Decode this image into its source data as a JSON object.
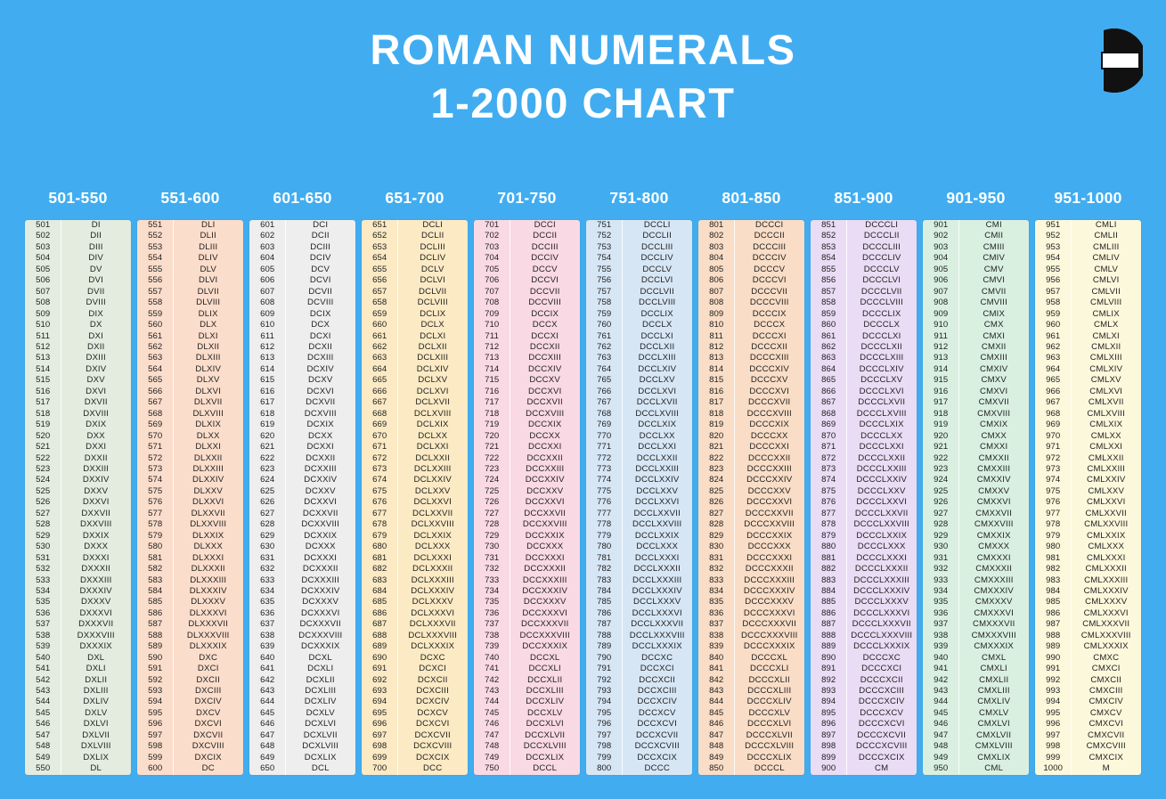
{
  "page": {
    "background_color": "#41adf0",
    "title_line1": "ROMAN NUMERALS",
    "title_line2": "1-2000 CHART"
  },
  "logo": {
    "name": "brand-logo",
    "shape": "semicircle-c-with-white-bar",
    "color": "#111111",
    "bar_color": "#ffffff"
  },
  "columns": [
    {
      "header": "501-550",
      "bg": "#e3ecdf",
      "start": 501,
      "end": 550,
      "numerals": [
        "DI",
        "DII",
        "DIII",
        "DIV",
        "DV",
        "DVI",
        "DVII",
        "DVIII",
        "DIX",
        "DX",
        "DXI",
        "DXII",
        "DXIII",
        "DXIV",
        "DXV",
        "DXVI",
        "DXVII",
        "DXVIII",
        "DXIX",
        "DXX",
        "DXXI",
        "DXXII",
        "DXXIII",
        "DXXIV",
        "DXXV",
        "DXXVI",
        "DXXVII",
        "DXXVIII",
        "DXXIX",
        "DXXX",
        "DXXXI",
        "DXXXII",
        "DXXXIII",
        "DXXXIV",
        "DXXXV",
        "DXXXVI",
        "DXXXVII",
        "DXXXVIII",
        "DXXXIX",
        "DXL",
        "DXLI",
        "DXLII",
        "DXLIII",
        "DXLIV",
        "DXLV",
        "DXLVI",
        "DXLVII",
        "DXLVIII",
        "DXLIX",
        "DL"
      ]
    },
    {
      "header": "551-600",
      "bg": "#fbddcb",
      "start": 551,
      "end": 600,
      "numerals": [
        "DLI",
        "DLII",
        "DLIII",
        "DLIV",
        "DLV",
        "DLVI",
        "DLVII",
        "DLVIII",
        "DLIX",
        "DLX",
        "DLXI",
        "DLXII",
        "DLXIII",
        "DLXIV",
        "DLXV",
        "DLXVI",
        "DLXVII",
        "DLXVIII",
        "DLXIX",
        "DLXX",
        "DLXXI",
        "DLXXII",
        "DLXXIII",
        "DLXXIV",
        "DLXXV",
        "DLXXVI",
        "DLXXVII",
        "DLXXVIII",
        "DLXXIX",
        "DLXXX",
        "DLXXXI",
        "DLXXXII",
        "DLXXXIII",
        "DLXXXIV",
        "DLXXXV",
        "DLXXXVI",
        "DLXXXVII",
        "DLXXXVIII",
        "DLXXXIX",
        "DXC",
        "DXCI",
        "DXCII",
        "DXCIII",
        "DXCIV",
        "DXCV",
        "DXCVI",
        "DXCVII",
        "DXCVIII",
        "DXCIX",
        "DC"
      ]
    },
    {
      "header": "601-650",
      "bg": "#eeeeee",
      "start": 601,
      "end": 650,
      "numerals": [
        "DCI",
        "DCII",
        "DCIII",
        "DCIV",
        "DCV",
        "DCVI",
        "DCVII",
        "DCVIII",
        "DCIX",
        "DCX",
        "DCXI",
        "DCXII",
        "DCXIII",
        "DCXIV",
        "DCXV",
        "DCXVI",
        "DCXVII",
        "DCXVIII",
        "DCXIX",
        "DCXX",
        "DCXXI",
        "DCXXII",
        "DCXXIII",
        "DCXXIV",
        "DCXXV",
        "DCXXVI",
        "DCXXVII",
        "DCXXVIII",
        "DCXXIX",
        "DCXXX",
        "DCXXXI",
        "DCXXXII",
        "DCXXXIII",
        "DCXXXIV",
        "DCXXXV",
        "DCXXXVI",
        "DCXXXVII",
        "DCXXXVIII",
        "DCXXXIX",
        "DCXL",
        "DCXLI",
        "DCXLII",
        "DCXLIII",
        "DCXLIV",
        "DCXLV",
        "DCXLVI",
        "DCXLVII",
        "DCXLVIII",
        "DCXLIX",
        "DCL"
      ]
    },
    {
      "header": "651-700",
      "bg": "#fbeac4",
      "start": 651,
      "end": 700,
      "numerals": [
        "DCLI",
        "DCLII",
        "DCLIII",
        "DCLIV",
        "DCLV",
        "DCLVI",
        "DCLVII",
        "DCLVIII",
        "DCLIX",
        "DCLX",
        "DCLXI",
        "DCLXII",
        "DCLXIII",
        "DCLXIV",
        "DCLXV",
        "DCLXVI",
        "DCLXVII",
        "DCLXVIII",
        "DCLXIX",
        "DCLXX",
        "DCLXXI",
        "DCLXXII",
        "DCLXXIII",
        "DCLXXIV",
        "DCLXXV",
        "DCLXXVI",
        "DCLXXVII",
        "DCLXXVIII",
        "DCLXXIX",
        "DCLXXX",
        "DCLXXXI",
        "DCLXXXII",
        "DCLXXXIII",
        "DCLXXXIV",
        "DCLXXXV",
        "DCLXXXVI",
        "DCLXXXVII",
        "DCLXXXVIII",
        "DCLXXXIX",
        "DCXC",
        "DCXCI",
        "DCXCII",
        "DCXCIII",
        "DCXCIV",
        "DCXCV",
        "DCXCVI",
        "DCXCVII",
        "DCXCVIII",
        "DCXCIX",
        "DCC"
      ]
    },
    {
      "header": "701-750",
      "bg": "#f9d9e4",
      "start": 701,
      "end": 750,
      "numerals": [
        "DCCI",
        "DCCII",
        "DCCIII",
        "DCCIV",
        "DCCV",
        "DCCVI",
        "DCCVII",
        "DCCVIII",
        "DCCIX",
        "DCCX",
        "DCCXI",
        "DCCXII",
        "DCCXIII",
        "DCCXIV",
        "DCCXV",
        "DCCXVI",
        "DCCXVII",
        "DCCXVIII",
        "DCCXIX",
        "DCCXX",
        "DCCXXI",
        "DCCXXII",
        "DCCXXIII",
        "DCCXXIV",
        "DCCXXV",
        "DCCXXVI",
        "DCCXXVII",
        "DCCXXVIII",
        "DCCXXIX",
        "DCCXXX",
        "DCCXXXI",
        "DCCXXXII",
        "DCCXXXIII",
        "DCCXXXIV",
        "DCCXXXV",
        "DCCXXXVI",
        "DCCXXXVII",
        "DCCXXXVIII",
        "DCCXXXIX",
        "DCCXL",
        "DCCXLI",
        "DCCXLII",
        "DCCXLIII",
        "DCCXLIV",
        "DCCXLV",
        "DCCXLVI",
        "DCCXLVII",
        "DCCXLVIII",
        "DCCXLIX",
        "DCCL"
      ]
    },
    {
      "header": "751-800",
      "bg": "#d7e6f5",
      "start": 751,
      "end": 800,
      "numerals": [
        "DCCLI",
        "DCCLII",
        "DCCLIII",
        "DCCLIV",
        "DCCLV",
        "DCCLVI",
        "DCCLVII",
        "DCCLVIII",
        "DCCLIX",
        "DCCLX",
        "DCCLXI",
        "DCCLXII",
        "DCCLXIII",
        "DCCLXIV",
        "DCCLXV",
        "DCCLXVI",
        "DCCLXVII",
        "DCCLXVIII",
        "DCCLXIX",
        "DCCLXX",
        "DCCLXXI",
        "DCCLXXII",
        "DCCLXXIII",
        "DCCLXXIV",
        "DCCLXXV",
        "DCCLXXVI",
        "DCCLXXVII",
        "DCCLXXVIII",
        "DCCLXXIX",
        "DCCLXXX",
        "DCCLXXXI",
        "DCCLXXXII",
        "DCCLXXXIII",
        "DCCLXXXIV",
        "DCCLXXXV",
        "DCCLXXXVI",
        "DCCLXXXVII",
        "DCCLXXXVIII",
        "DCCLXXXIX",
        "DCCXC",
        "DCCXCI",
        "DCCXCII",
        "DCCXCIII",
        "DCCXCIV",
        "DCCXCV",
        "DCCXCVI",
        "DCCXCVII",
        "DCCXCVIII",
        "DCCXCIX",
        "DCCC"
      ]
    },
    {
      "header": "801-850",
      "bg": "#f9ddc6",
      "start": 801,
      "end": 850,
      "numerals": [
        "DCCCI",
        "DCCCII",
        "DCCCIII",
        "DCCCIV",
        "DCCCV",
        "DCCCVI",
        "DCCCVII",
        "DCCCVIII",
        "DCCCIX",
        "DCCCX",
        "DCCCXI",
        "DCCCXII",
        "DCCCXIII",
        "DCCCXIV",
        "DCCCXV",
        "DCCCXVI",
        "DCCCXVII",
        "DCCCXVIII",
        "DCCCXIX",
        "DCCCXX",
        "DCCCXXI",
        "DCCCXXII",
        "DCCCXXIII",
        "DCCCXXIV",
        "DCCCXXV",
        "DCCCXXVI",
        "DCCCXXVII",
        "DCCCXXVIII",
        "DCCCXXIX",
        "DCCCXXX",
        "DCCCXXXI",
        "DCCCXXXII",
        "DCCCXXXIII",
        "DCCCXXXIV",
        "DCCCXXXV",
        "DCCCXXXVI",
        "DCCCXXXVII",
        "DCCCXXXVIII",
        "DCCCXXXIX",
        "DCCCXL",
        "DCCCXLI",
        "DCCCXLII",
        "DCCCXLIII",
        "DCCCXLIV",
        "DCCCXLV",
        "DCCCXLVI",
        "DCCCXLVII",
        "DCCCXLVIII",
        "DCCCXLIX",
        "DCCCL"
      ]
    },
    {
      "header": "851-900",
      "bg": "#eadcf5",
      "start": 851,
      "end": 900,
      "numerals": [
        "DCCCLI",
        "DCCCLII",
        "DCCCLIII",
        "DCCCLIV",
        "DCCCLV",
        "DCCCLVI",
        "DCCCLVII",
        "DCCCLVIII",
        "DCCCLIX",
        "DCCCLX",
        "DCCCLXI",
        "DCCCLXII",
        "DCCCLXIII",
        "DCCCLXIV",
        "DCCCLXV",
        "DCCCLXVI",
        "DCCCLXVII",
        "DCCCLXVIII",
        "DCCCLXIX",
        "DCCCLXX",
        "DCCCLXXI",
        "DCCCLXXII",
        "DCCCLXXIII",
        "DCCCLXXIV",
        "DCCCLXXV",
        "DCCCLXXVI",
        "DCCCLXXVII",
        "DCCCLXXVIII",
        "DCCCLXXIX",
        "DCCCLXXX",
        "DCCCLXXXI",
        "DCCCLXXXII",
        "DCCCLXXXIII",
        "DCCCLXXXIV",
        "DCCCLXXXV",
        "DCCCLXXXVI",
        "DCCCLXXXVII",
        "DCCCLXXXVIII",
        "DCCCLXXXIX",
        "DCCCXC",
        "DCCCXCI",
        "DCCCXCII",
        "DCCCXCIII",
        "DCCCXCIV",
        "DCCCXCV",
        "DCCCXCVI",
        "DCCCXCVII",
        "DCCCXCVIII",
        "DCCCXCIX",
        "CM"
      ]
    },
    {
      "header": "901-950",
      "bg": "#d9f0e1",
      "start": 901,
      "end": 950,
      "numerals": [
        "CMI",
        "CMII",
        "CMIII",
        "CMIV",
        "CMV",
        "CMVI",
        "CMVII",
        "CMVIII",
        "CMIX",
        "CMX",
        "CMXI",
        "CMXII",
        "CMXIII",
        "CMXIV",
        "CMXV",
        "CMXVI",
        "CMXVII",
        "CMXVIII",
        "CMXIX",
        "CMXX",
        "CMXXI",
        "CMXXII",
        "CMXXIII",
        "CMXXIV",
        "CMXXV",
        "CMXXVI",
        "CMXXVII",
        "CMXXVIII",
        "CMXXIX",
        "CMXXX",
        "CMXXXI",
        "CMXXXII",
        "CMXXXIII",
        "CMXXXIV",
        "CMXXXV",
        "CMXXXVI",
        "CMXXXVII",
        "CMXXXVIII",
        "CMXXXIX",
        "CMXL",
        "CMXLI",
        "CMXLII",
        "CMXLIII",
        "CMXLIV",
        "CMXLV",
        "CMXLVI",
        "CMXLVII",
        "CMXLVIII",
        "CMXLIX",
        "CML"
      ]
    },
    {
      "header": "951-1000",
      "bg": "#fbf8dc",
      "start": 951,
      "end": 1000,
      "numerals": [
        "CMLI",
        "CMLII",
        "CMLIII",
        "CMLIV",
        "CMLV",
        "CMLVI",
        "CMLVII",
        "CMLVIII",
        "CMLIX",
        "CMLX",
        "CMLXI",
        "CMLXII",
        "CMLXIII",
        "CMLXIV",
        "CMLXV",
        "CMLXVI",
        "CMLXVII",
        "CMLXVIII",
        "CMLXIX",
        "CMLXX",
        "CMLXXI",
        "CMLXXII",
        "CMLXXIII",
        "CMLXXIV",
        "CMLXXV",
        "CMLXXVI",
        "CMLXXVII",
        "CMLXXVIII",
        "CMLXXIX",
        "CMLXXX",
        "CMLXXXI",
        "CMLXXXII",
        "CMLXXXIII",
        "CMLXXXIV",
        "CMLXXXV",
        "CMLXXXVI",
        "CMLXXXVII",
        "CMLXXXVIII",
        "CMLXXXIX",
        "CMXC",
        "CMXCI",
        "CMXCII",
        "CMXCIII",
        "CMXCIV",
        "CMXCV",
        "CMXCVI",
        "CMXCVII",
        "CMXCVIII",
        "CMXCIX",
        "M"
      ]
    }
  ]
}
